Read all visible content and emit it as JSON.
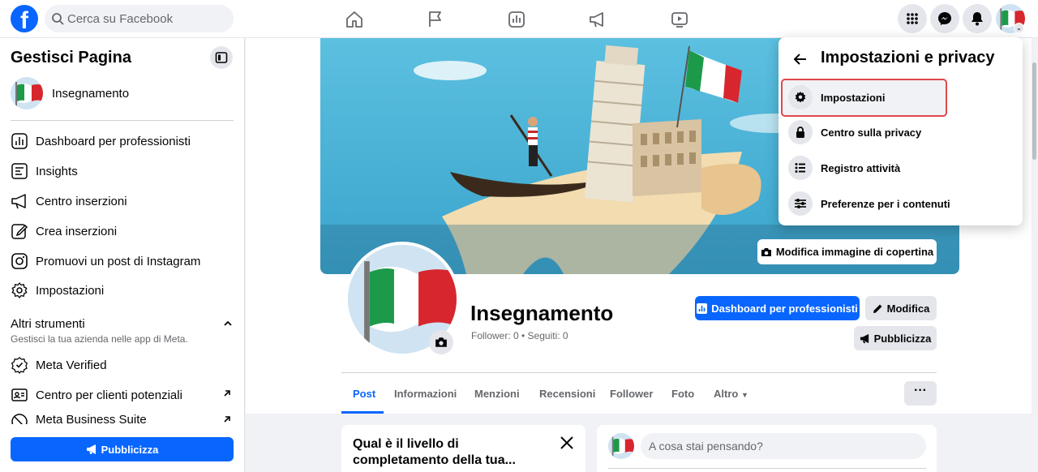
{
  "brand": {
    "logo_glyph": "f",
    "accent": "#0866ff"
  },
  "search": {
    "placeholder": "Cerca su Facebook"
  },
  "sidebar": {
    "title": "Gestisci Pagina",
    "page_name": "Insegnamento",
    "items": [
      {
        "label": "Dashboard per professionisti",
        "icon": "dashboard-icon"
      },
      {
        "label": "Insights",
        "icon": "insights-icon"
      },
      {
        "label": "Centro inserzioni",
        "icon": "megaphone-icon"
      },
      {
        "label": "Crea inserzioni",
        "icon": "edit-icon"
      },
      {
        "label": "Promuovi un post di Instagram",
        "icon": "instagram-icon"
      },
      {
        "label": "Impostazioni",
        "icon": "gear-icon"
      }
    ],
    "tools_section": {
      "title": "Altri strumenti",
      "subtitle": "Gestisci la tua azienda nelle app di Meta."
    },
    "tools": [
      {
        "label": "Meta Verified",
        "icon": "verified-icon"
      },
      {
        "label": "Centro per clienti potenziali",
        "icon": "leads-icon"
      },
      {
        "label": "Meta Business Suite",
        "icon": "business-suite-icon"
      }
    ],
    "cta": "Pubblicizza"
  },
  "profile": {
    "name": "Insegnamento",
    "stats": "Follower: 0 • Seguiti: 0",
    "edit_cover": "Modifica immagine di copertina",
    "dashboard_btn": "Dashboard per professionisti",
    "edit_btn": "Modifica",
    "promote_btn": "Pubblicizza"
  },
  "tabs": [
    "Post",
    "Informazioni",
    "Menzioni",
    "Recensioni",
    "Follower",
    "Foto",
    "Altro"
  ],
  "more_label": "···",
  "cards": {
    "completion_title": "Qual è il livello di completamento della tua...",
    "composer_placeholder": "A cosa stai pensando?"
  },
  "dropdown": {
    "title": "Impostazioni e privacy",
    "items": [
      {
        "label": "Impostazioni",
        "icon": "gear-icon"
      },
      {
        "label": "Centro sulla privacy",
        "icon": "lock-icon"
      },
      {
        "label": "Registro attività",
        "icon": "list-icon"
      },
      {
        "label": "Preferenze per i contenuti",
        "icon": "sliders-icon"
      }
    ],
    "highlight_color": "#e0474c"
  }
}
